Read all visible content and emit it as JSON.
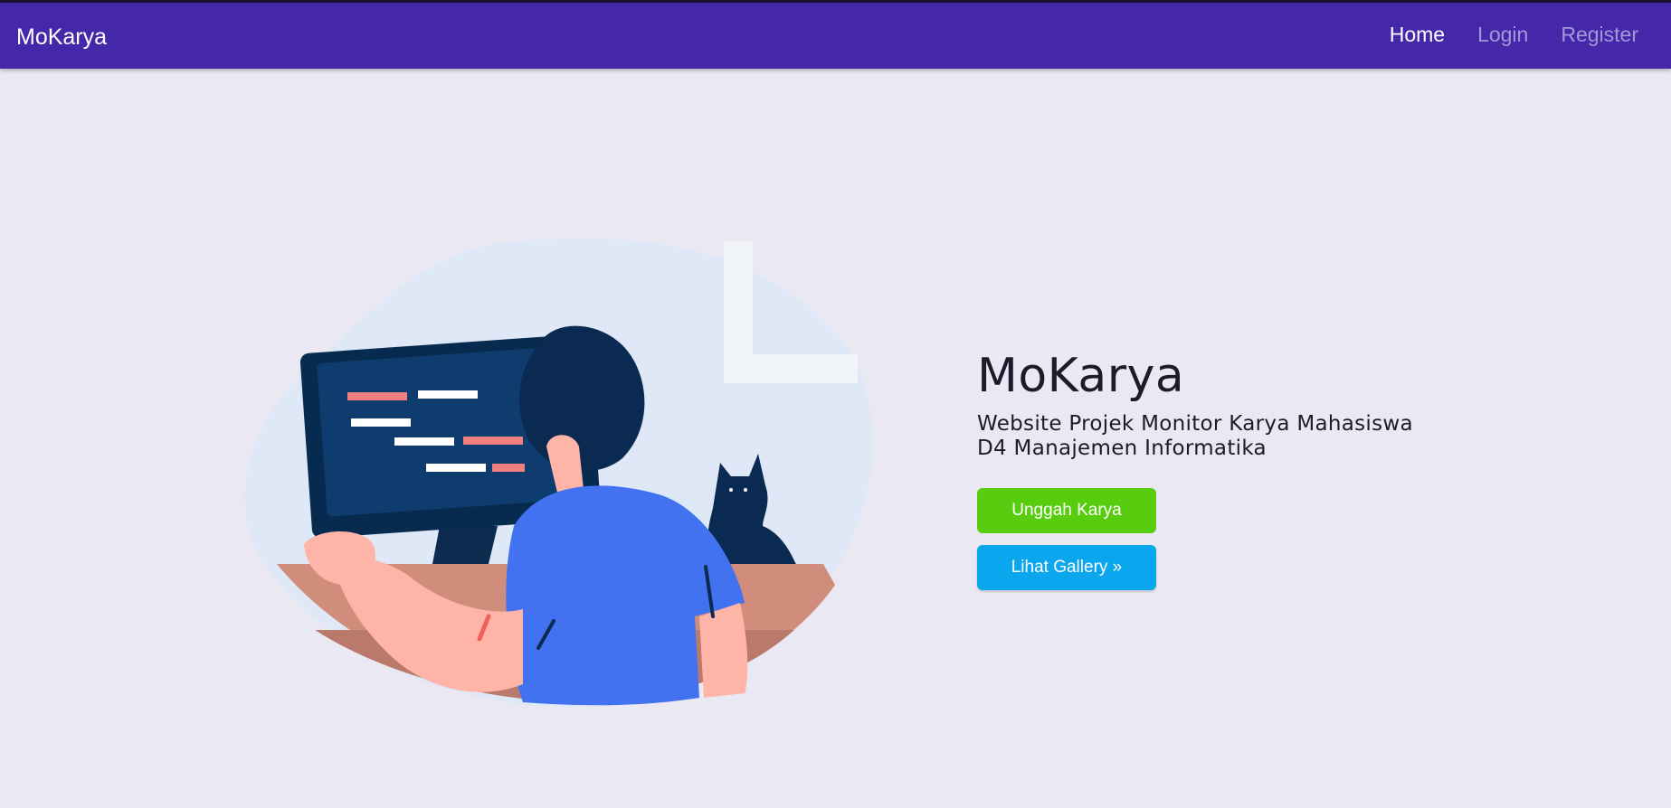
{
  "navbar": {
    "brand": "MoKarya",
    "links": [
      {
        "label": "Home",
        "active": true
      },
      {
        "label": "Login",
        "active": false
      },
      {
        "label": "Register",
        "active": false
      }
    ]
  },
  "hero": {
    "title": "MoKarya",
    "subtitle_line1": "Website Projek Monitor Karya Mahasiswa",
    "subtitle_line2": "D4 Manajemen Informatika",
    "buttons": {
      "upload_label": "Unggah Karya",
      "gallery_label": "Lihat Gallery »"
    }
  },
  "colors": {
    "navbar": "#4527a9",
    "background": "#eae8f3",
    "upload_button": "#58cc0e",
    "gallery_button": "#0aa7ef"
  },
  "illustration": {
    "name": "developer-at-computer-with-cat-illustration"
  }
}
